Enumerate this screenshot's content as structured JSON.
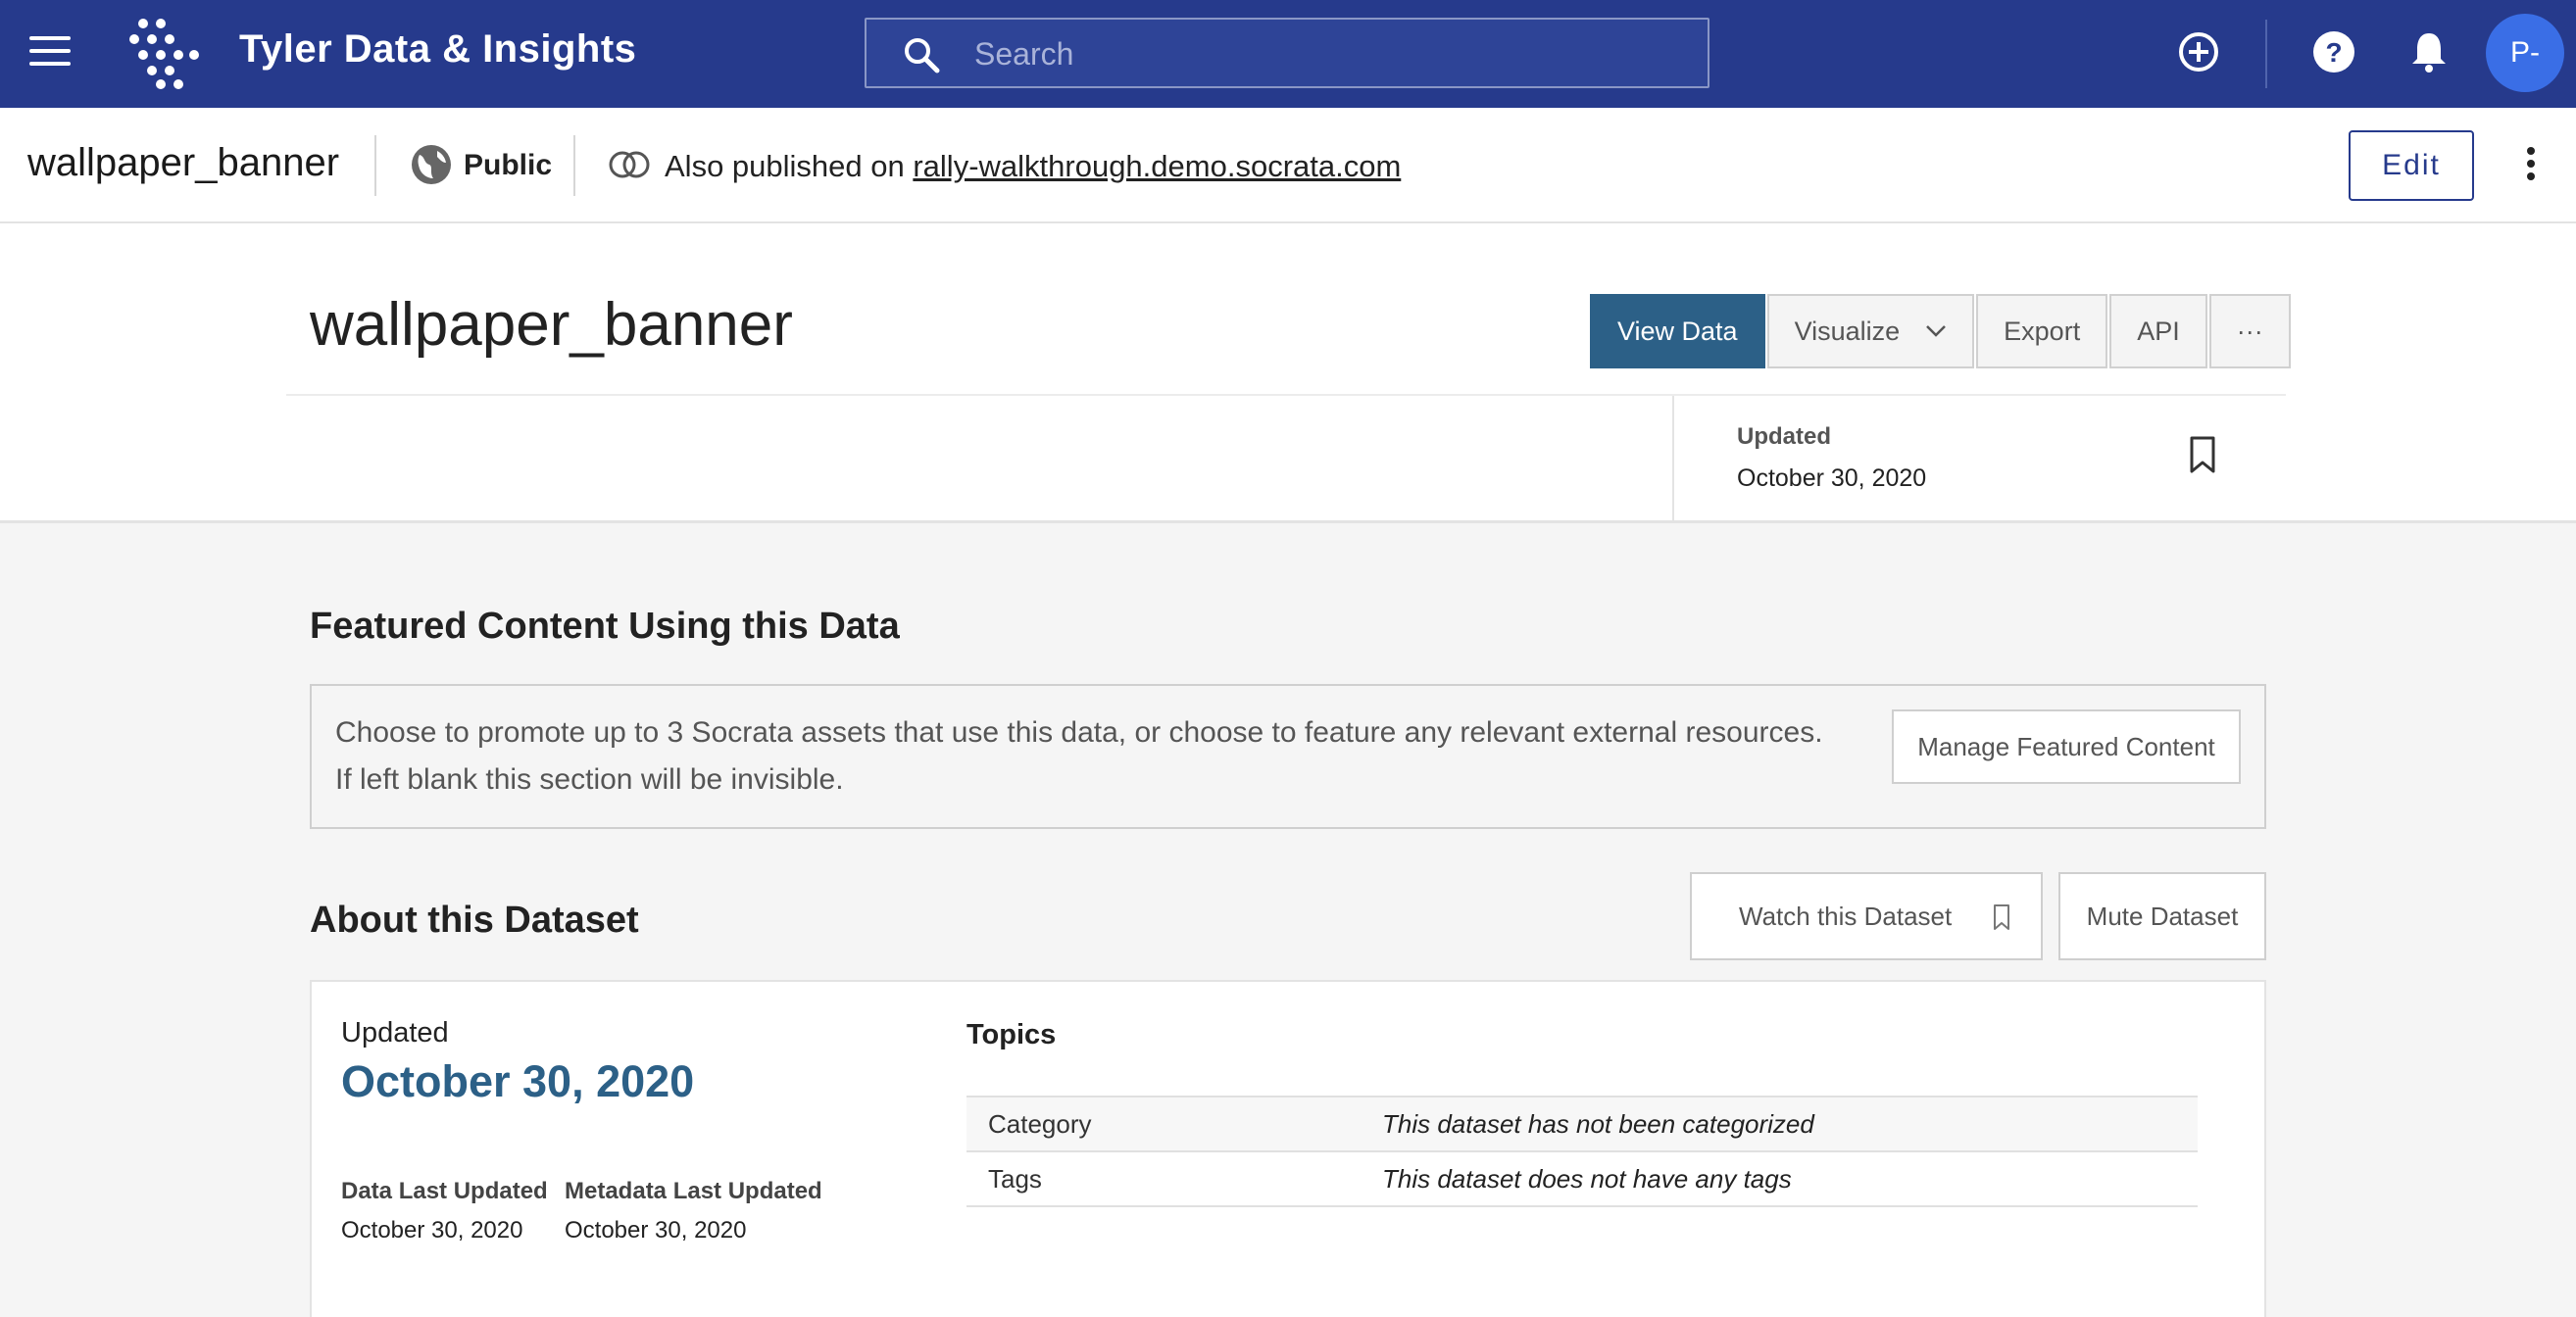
{
  "topnav": {
    "brand": "Tyler Data & Insights",
    "search_placeholder": "Search",
    "avatar_initials": "P-"
  },
  "titlebar": {
    "dataset_name": "wallpaper_banner",
    "visibility": "Public",
    "also_published_prefix": "Also published on",
    "also_published_link": "rally-walkthrough.demo.socrata.com",
    "edit_label": "Edit"
  },
  "header": {
    "title": "wallpaper_banner",
    "actions": {
      "view_data": "View Data",
      "visualize": "Visualize",
      "export": "Export",
      "api": "API",
      "more": "···"
    },
    "updated_label": "Updated",
    "updated_date": "October 30, 2020"
  },
  "featured": {
    "title": "Featured Content Using this Data",
    "description": "Choose to promote up to 3 Socrata assets that use this data, or choose to feature any relevant external resources. If left blank this section will be invisible.",
    "manage_label": "Manage Featured Content"
  },
  "about": {
    "title": "About this Dataset",
    "watch_label": "Watch this Dataset",
    "mute_label": "Mute Dataset",
    "updated_label": "Updated",
    "updated_date": "October 30, 2020",
    "data_last_updated_label": "Data Last Updated",
    "data_last_updated": "October 30, 2020",
    "metadata_last_updated_label": "Metadata Last Updated",
    "metadata_last_updated": "October 30, 2020",
    "topics_title": "Topics",
    "topics": [
      {
        "key": "Category",
        "value": "This dataset has not been categorized"
      },
      {
        "key": "Tags",
        "value": "This dataset does not have any tags"
      }
    ]
  },
  "colors": {
    "nav_bg": "#263a8c",
    "primary_button": "#2c6087",
    "avatar": "#3a6ee6"
  }
}
